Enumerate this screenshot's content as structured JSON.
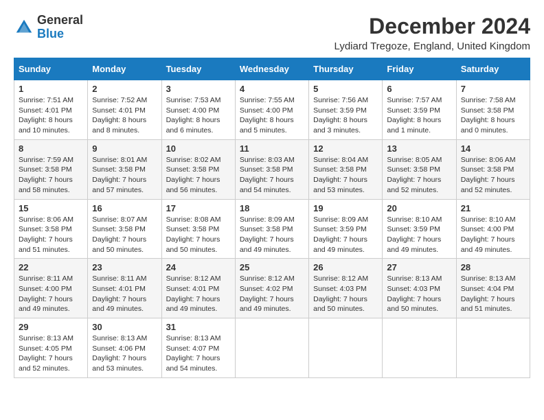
{
  "header": {
    "logo": {
      "line1": "General",
      "line2": "Blue"
    },
    "title": "December 2024",
    "location": "Lydiard Tregoze, England, United Kingdom"
  },
  "days_of_week": [
    "Sunday",
    "Monday",
    "Tuesday",
    "Wednesday",
    "Thursday",
    "Friday",
    "Saturday"
  ],
  "weeks": [
    [
      {
        "day": "1",
        "sunrise": "7:51 AM",
        "sunset": "4:01 PM",
        "daylight": "8 hours and 10 minutes."
      },
      {
        "day": "2",
        "sunrise": "7:52 AM",
        "sunset": "4:01 PM",
        "daylight": "8 hours and 8 minutes."
      },
      {
        "day": "3",
        "sunrise": "7:53 AM",
        "sunset": "4:00 PM",
        "daylight": "8 hours and 6 minutes."
      },
      {
        "day": "4",
        "sunrise": "7:55 AM",
        "sunset": "4:00 PM",
        "daylight": "8 hours and 5 minutes."
      },
      {
        "day": "5",
        "sunrise": "7:56 AM",
        "sunset": "3:59 PM",
        "daylight": "8 hours and 3 minutes."
      },
      {
        "day": "6",
        "sunrise": "7:57 AM",
        "sunset": "3:59 PM",
        "daylight": "8 hours and 1 minute."
      },
      {
        "day": "7",
        "sunrise": "7:58 AM",
        "sunset": "3:58 PM",
        "daylight": "8 hours and 0 minutes."
      }
    ],
    [
      {
        "day": "8",
        "sunrise": "7:59 AM",
        "sunset": "3:58 PM",
        "daylight": "7 hours and 58 minutes."
      },
      {
        "day": "9",
        "sunrise": "8:01 AM",
        "sunset": "3:58 PM",
        "daylight": "7 hours and 57 minutes."
      },
      {
        "day": "10",
        "sunrise": "8:02 AM",
        "sunset": "3:58 PM",
        "daylight": "7 hours and 56 minutes."
      },
      {
        "day": "11",
        "sunrise": "8:03 AM",
        "sunset": "3:58 PM",
        "daylight": "7 hours and 54 minutes."
      },
      {
        "day": "12",
        "sunrise": "8:04 AM",
        "sunset": "3:58 PM",
        "daylight": "7 hours and 53 minutes."
      },
      {
        "day": "13",
        "sunrise": "8:05 AM",
        "sunset": "3:58 PM",
        "daylight": "7 hours and 52 minutes."
      },
      {
        "day": "14",
        "sunrise": "8:06 AM",
        "sunset": "3:58 PM",
        "daylight": "7 hours and 52 minutes."
      }
    ],
    [
      {
        "day": "15",
        "sunrise": "8:06 AM",
        "sunset": "3:58 PM",
        "daylight": "7 hours and 51 minutes."
      },
      {
        "day": "16",
        "sunrise": "8:07 AM",
        "sunset": "3:58 PM",
        "daylight": "7 hours and 50 minutes."
      },
      {
        "day": "17",
        "sunrise": "8:08 AM",
        "sunset": "3:58 PM",
        "daylight": "7 hours and 50 minutes."
      },
      {
        "day": "18",
        "sunrise": "8:09 AM",
        "sunset": "3:58 PM",
        "daylight": "7 hours and 49 minutes."
      },
      {
        "day": "19",
        "sunrise": "8:09 AM",
        "sunset": "3:59 PM",
        "daylight": "7 hours and 49 minutes."
      },
      {
        "day": "20",
        "sunrise": "8:10 AM",
        "sunset": "3:59 PM",
        "daylight": "7 hours and 49 minutes."
      },
      {
        "day": "21",
        "sunrise": "8:10 AM",
        "sunset": "4:00 PM",
        "daylight": "7 hours and 49 minutes."
      }
    ],
    [
      {
        "day": "22",
        "sunrise": "8:11 AM",
        "sunset": "4:00 PM",
        "daylight": "7 hours and 49 minutes."
      },
      {
        "day": "23",
        "sunrise": "8:11 AM",
        "sunset": "4:01 PM",
        "daylight": "7 hours and 49 minutes."
      },
      {
        "day": "24",
        "sunrise": "8:12 AM",
        "sunset": "4:01 PM",
        "daylight": "7 hours and 49 minutes."
      },
      {
        "day": "25",
        "sunrise": "8:12 AM",
        "sunset": "4:02 PM",
        "daylight": "7 hours and 49 minutes."
      },
      {
        "day": "26",
        "sunrise": "8:12 AM",
        "sunset": "4:03 PM",
        "daylight": "7 hours and 50 minutes."
      },
      {
        "day": "27",
        "sunrise": "8:13 AM",
        "sunset": "4:03 PM",
        "daylight": "7 hours and 50 minutes."
      },
      {
        "day": "28",
        "sunrise": "8:13 AM",
        "sunset": "4:04 PM",
        "daylight": "7 hours and 51 minutes."
      }
    ],
    [
      {
        "day": "29",
        "sunrise": "8:13 AM",
        "sunset": "4:05 PM",
        "daylight": "7 hours and 52 minutes."
      },
      {
        "day": "30",
        "sunrise": "8:13 AM",
        "sunset": "4:06 PM",
        "daylight": "7 hours and 53 minutes."
      },
      {
        "day": "31",
        "sunrise": "8:13 AM",
        "sunset": "4:07 PM",
        "daylight": "7 hours and 54 minutes."
      },
      null,
      null,
      null,
      null
    ]
  ]
}
